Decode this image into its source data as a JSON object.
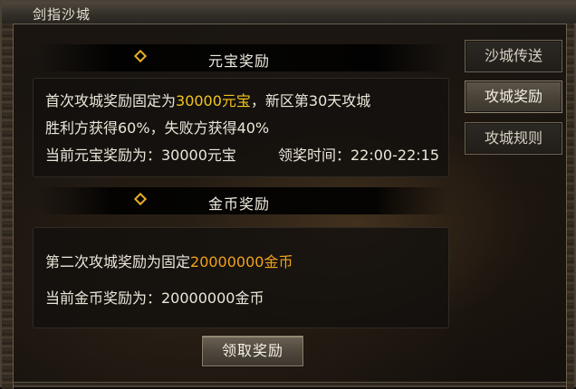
{
  "window": {
    "title": "剑指沙城"
  },
  "sections": {
    "yuanbao": {
      "header": "元宝奖励",
      "line1_prefix": "首次攻城奖励固定为",
      "line1_highlight": "30000元宝",
      "line1_suffix": "，新区第30天攻城",
      "line2": "胜利方获得60%，失败方获得40%",
      "line3_current": "当前元宝奖励为：30000元宝",
      "line3_time": "领奖时间：22:00-22:15"
    },
    "gold": {
      "header": "金币奖励",
      "line1_prefix": "第二次攻城奖励为固定",
      "line1_highlight": "20000000金币",
      "line2": "当前金币奖励为：20000000金币"
    }
  },
  "tabs": [
    {
      "label": "沙城传送",
      "active": false
    },
    {
      "label": "攻城奖励",
      "active": true
    },
    {
      "label": "攻城规则",
      "active": false
    }
  ],
  "claim_button": {
    "label": "领取奖励"
  },
  "colors": {
    "highlight_yellow": "#f3c520",
    "highlight_orange": "#f1a21b",
    "diamond": "#e7b020"
  },
  "icons": {
    "section_marker": "diamond-icon"
  }
}
